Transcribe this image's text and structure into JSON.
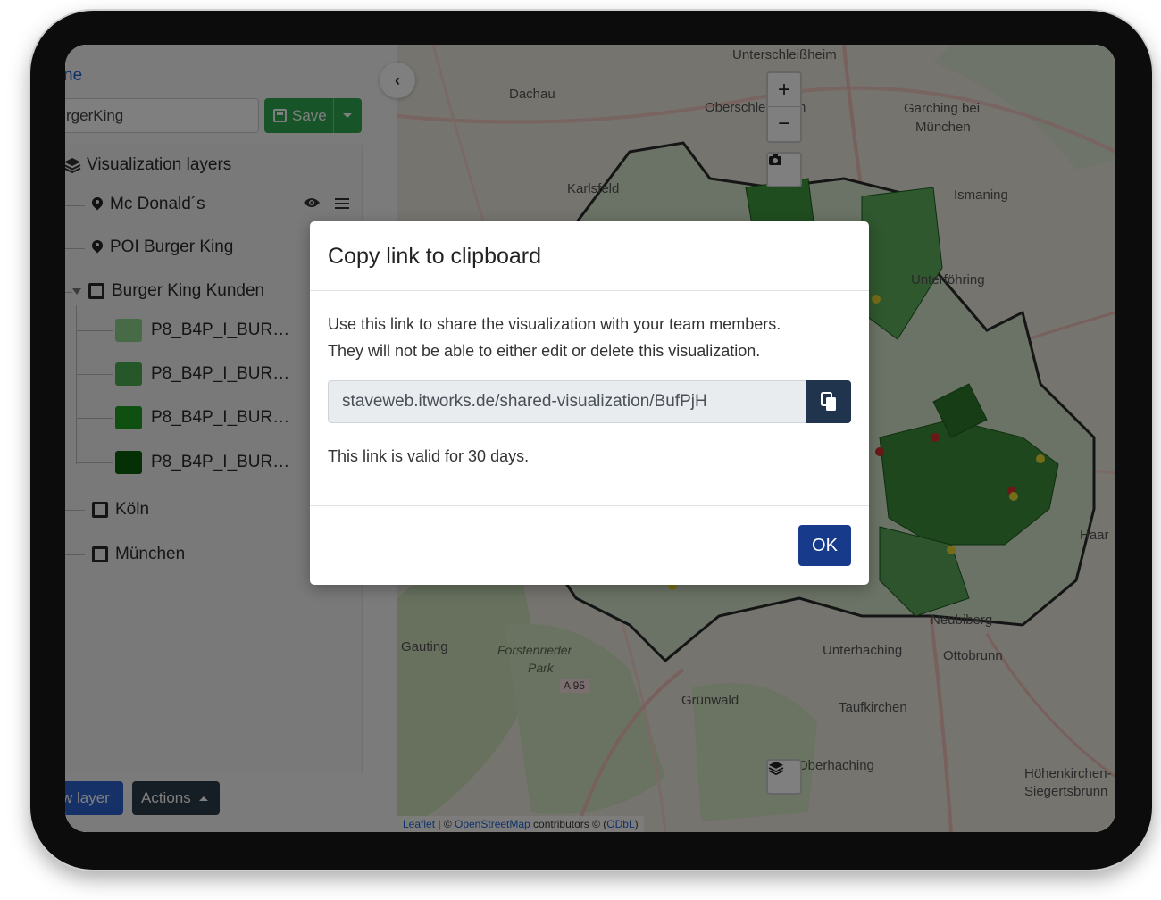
{
  "sidebar": {
    "top_link": "ne",
    "name_value": "rgerKing",
    "save_label": "Save",
    "layers_title": "Visualization layers",
    "layers": [
      {
        "label": "Mc Donald´s"
      },
      {
        "label": "POI Burger King"
      },
      {
        "label": "Burger King Kunden"
      },
      {
        "label": "P8_B4P_I_BUR…",
        "color": "#8fd48f"
      },
      {
        "label": "P8_B4P_I_BUR…",
        "color": "#4caf50"
      },
      {
        "label": "P8_B4P_I_BUR…",
        "color": "#1e9e1e"
      },
      {
        "label": "P8_B4P_I_BUR…",
        "color": "#0b5e0b"
      },
      {
        "label": "Köln"
      },
      {
        "label": "München"
      }
    ],
    "add_layer_label": "w layer",
    "actions_label": "Actions"
  },
  "map": {
    "places": [
      "Unterschleißheim",
      "Dachau",
      "Oberschleißheim",
      "Garching bei",
      "München",
      "Karlsfeld",
      "Ismaning",
      "Unterföhring",
      "Haar",
      "Neubiberg",
      "Gauting",
      "Unterhaching",
      "Ottobrunn",
      "Grünwald",
      "Taufkirchen",
      "Oberhaching",
      "Höhenkirchen-",
      "Siegertsbrunn"
    ],
    "forest": [
      "Forstenrieder",
      "Park"
    ],
    "road": "A 95",
    "attribution": {
      "leaflet": "Leaflet",
      "sep": " | © ",
      "osm": "OpenStreetMap",
      "contrib": " contributors © (",
      "odbl": "ODbL",
      "close": ")"
    }
  },
  "modal": {
    "title": "Copy link to clipboard",
    "line1": "Use this link to share the visualization with your team members.",
    "line2": "They will not be able to either edit or delete this visualization.",
    "link": "staveweb.itworks.de/shared-visualization/BufPjH",
    "validity": "This link is valid for 30 days.",
    "ok_label": "OK"
  }
}
